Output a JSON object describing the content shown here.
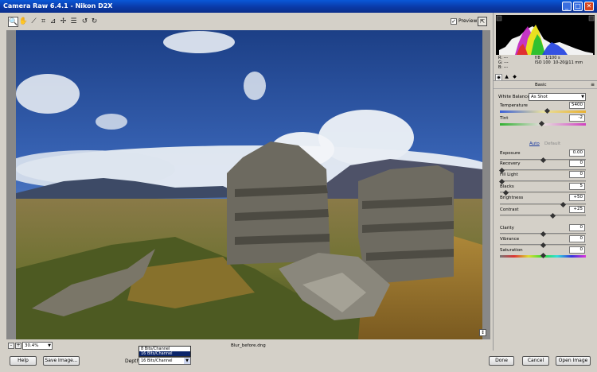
{
  "window": {
    "title": "Camera Raw 6.4.1  -  Nikon D2X",
    "controls": {
      "minimize": "_",
      "maximize": "□",
      "close": "✕"
    }
  },
  "toolbar": {
    "tools": [
      {
        "icon": "zoom-icon",
        "glyph": "🔍"
      },
      {
        "icon": "hand-icon",
        "glyph": "✋"
      },
      {
        "icon": "eyedropper-icon",
        "glyph": "⟋"
      },
      {
        "icon": "crop-icon",
        "glyph": "⌗"
      },
      {
        "icon": "straighten-icon",
        "glyph": "⊿"
      },
      {
        "icon": "spot-removal-icon",
        "glyph": "✢"
      },
      {
        "icon": "list-icon",
        "glyph": "☰"
      },
      {
        "icon": "rotate-left-icon",
        "glyph": "↺"
      },
      {
        "icon": "rotate-right-icon",
        "glyph": "↻"
      }
    ],
    "preview_label": "Preview",
    "preview_checked": "✓",
    "fullscreen_glyph": "⇱"
  },
  "image": {
    "filename": "Blur_before.dng",
    "zoom": "30.4%",
    "zoom_minus": "-",
    "zoom_plus": "+"
  },
  "info": {
    "r_label": "R:",
    "g_label": "G:",
    "b_label": "B:",
    "r_value": "---",
    "g_value": "---",
    "b_value": "---",
    "aperture": "f/8",
    "shutter": "1/100 s",
    "iso": "ISO 100",
    "lens": "10-20@11 mm"
  },
  "panel": {
    "section_title": "Basic",
    "white_balance_label": "White Balance:",
    "white_balance_value": "As Shot",
    "auto_label": "Auto",
    "default_label": "Default",
    "sliders": [
      {
        "key": "temperature",
        "label": "Temperature",
        "value": "5400",
        "fraction": 0.55
      },
      {
        "key": "tint",
        "label": "Tint",
        "value": "-2",
        "fraction": 0.49
      },
      {
        "key": "exposure",
        "label": "Exposure",
        "value": "0.00",
        "fraction": 0.5
      },
      {
        "key": "recovery",
        "label": "Recovery",
        "value": "0",
        "fraction": 0.0
      },
      {
        "key": "fill-light",
        "label": "Fill Light",
        "value": "0",
        "fraction": 0.0
      },
      {
        "key": "blacks",
        "label": "Blacks",
        "value": "5",
        "fraction": 0.05
      },
      {
        "key": "brightness",
        "label": "Brightness",
        "value": "+50",
        "fraction": 0.75
      },
      {
        "key": "contrast",
        "label": "Contrast",
        "value": "+25",
        "fraction": 0.62
      },
      {
        "key": "clarity",
        "label": "Clarity",
        "value": "0",
        "fraction": 0.5
      },
      {
        "key": "vibrance",
        "label": "Vibrance",
        "value": "0",
        "fraction": 0.5
      },
      {
        "key": "saturation",
        "label": "Saturation",
        "value": "0",
        "fraction": 0.5
      }
    ]
  },
  "bottom": {
    "help": "Help",
    "save_image": "Save Image...",
    "depth_label": "Depth:",
    "depth_value": "16 Bits/Channel",
    "depth_options": [
      "8 Bits/Channel",
      "16 Bits/Channel"
    ],
    "depth_selected_index": 1,
    "done": "Done",
    "cancel": "Cancel",
    "open_image": "Open Image"
  },
  "colors": {
    "titlebar": "#0a3aa8",
    "selection": "#0a246a",
    "chrome": "#d4d0c8"
  }
}
